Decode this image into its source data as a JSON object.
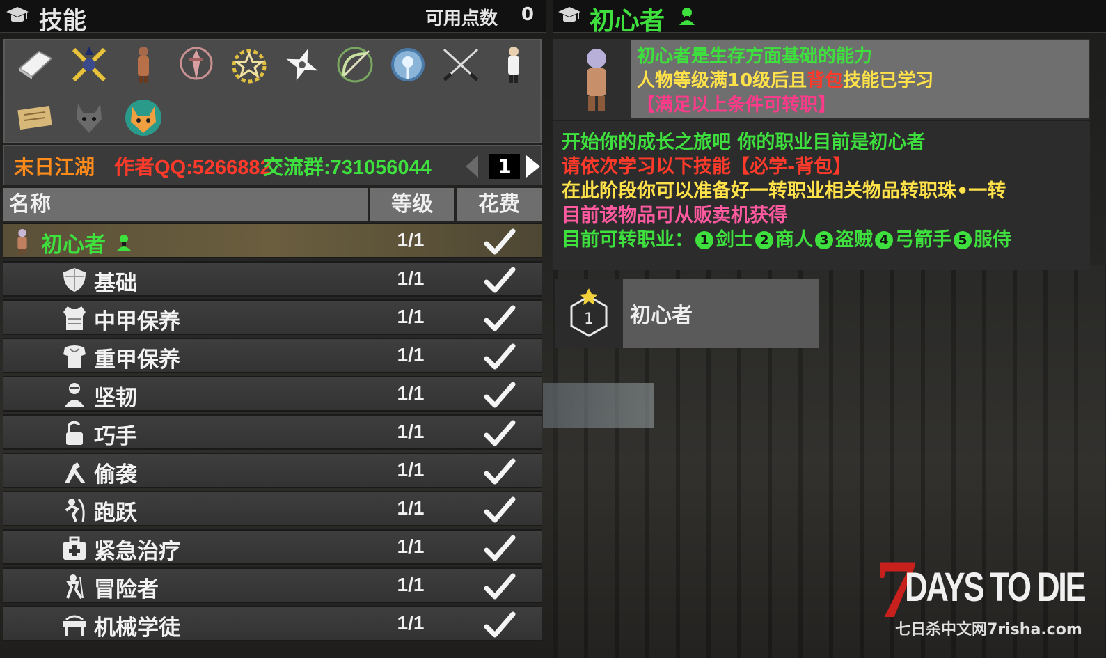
{
  "left": {
    "title": "技能",
    "points_label": "可用点数",
    "points_value": "0",
    "grid_icons": [
      "book-icon",
      "crossed-swords-gold-icon",
      "merchant-character-icon",
      "dagger-shield-icon",
      "laurel-star-icon",
      "shuriken-icon",
      "bow-arrow-icon",
      "orb-icon",
      "crossed-blades-icon",
      "servant-character-icon",
      "scroll-icon",
      "wolf-icon",
      "fox-icon"
    ],
    "info": {
      "part1": "末日江湖",
      "part2": "作者QQ:5266882",
      "part3": "交流群:731056044",
      "page": "1"
    },
    "table": {
      "headers": {
        "name": "名称",
        "level": "等级",
        "cost": "花费"
      },
      "rows": [
        {
          "name": "初心者",
          "level": "1/1",
          "icon": "novice-character-icon",
          "active": true,
          "badge": "class-emblem-icon"
        },
        {
          "name": "基础",
          "level": "1/1",
          "icon": "shield-icon"
        },
        {
          "name": "中甲保养",
          "level": "1/1",
          "icon": "vest-armor-icon"
        },
        {
          "name": "重甲保养",
          "level": "1/1",
          "icon": "heavy-armor-icon"
        },
        {
          "name": "坚韧",
          "level": "1/1",
          "icon": "tough-person-icon"
        },
        {
          "name": "巧手",
          "level": "1/1",
          "icon": "padlock-icon"
        },
        {
          "name": "偷袭",
          "level": "1/1",
          "icon": "sneak-icon"
        },
        {
          "name": "跑跃",
          "level": "1/1",
          "icon": "run-jump-icon"
        },
        {
          "name": "紧急治疗",
          "level": "1/1",
          "icon": "medkit-icon"
        },
        {
          "name": "冒险者",
          "level": "1/1",
          "icon": "adventurer-icon"
        },
        {
          "name": "机械学徒",
          "level": "1/1",
          "icon": "workbench-icon"
        }
      ]
    }
  },
  "right": {
    "title": "初心者",
    "desc": {
      "line1": "初心者是生存方面基础的能力",
      "line2_a": "人物等级满10级后且",
      "line2_b": "背包",
      "line2_c": "技能已学习",
      "line3": "【满足以上条件可转职】"
    },
    "text": {
      "line1": "开始你的成长之旅吧 你的职业目前是初心者",
      "line2": "请依次学习以下技能【必学-背包】",
      "line3": "在此阶段你可以准备好一转职业相关物品转职珠•一转",
      "line4": "目前该物品可从贩卖机获得",
      "line5_label": "目前可转职业：",
      "jobs": [
        {
          "num": "1",
          "name": "剑士"
        },
        {
          "num": "2",
          "name": "商人"
        },
        {
          "num": "3",
          "name": "盗贼"
        },
        {
          "num": "4",
          "name": "弓箭手"
        },
        {
          "num": "5",
          "name": "服侍"
        }
      ]
    },
    "tier": {
      "number": "1",
      "label": "初心者"
    }
  },
  "logo": {
    "seven": "7",
    "days": "DAYS TO DIE",
    "sub": "七日杀中文网7risha.com"
  },
  "colors": {
    "green": "#3ee03e",
    "red": "#ff3a2a",
    "orange": "#ff8c1a",
    "yellow": "#ffe24a",
    "pink": "#ff5aa0"
  }
}
